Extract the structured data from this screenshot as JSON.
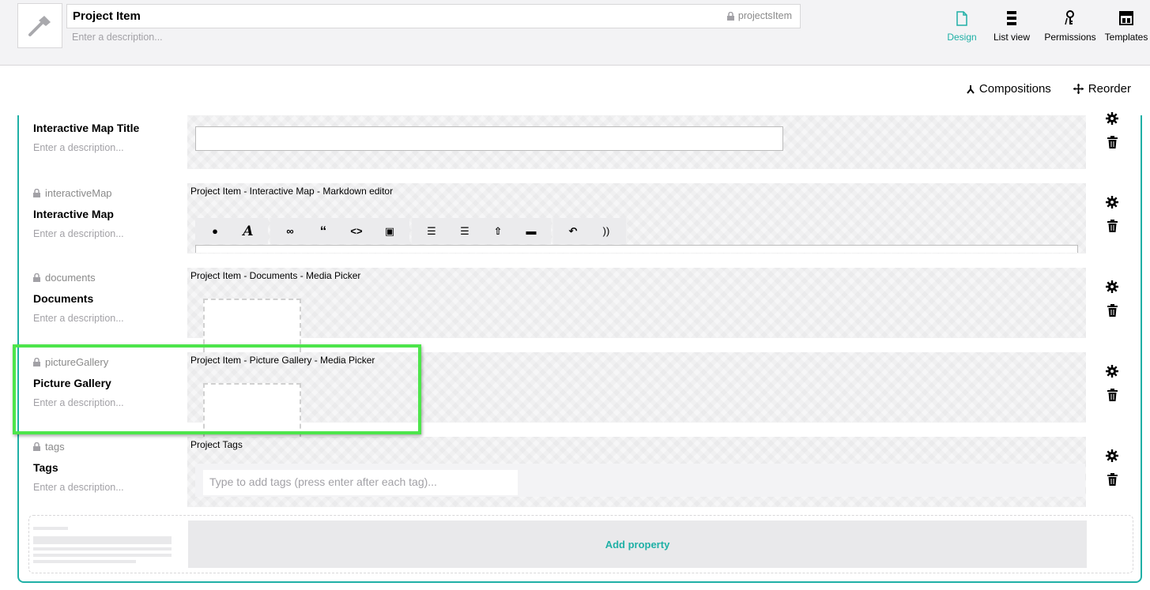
{
  "header": {
    "name": "Project Item",
    "alias": "projectsItem",
    "description_placeholder": "Enter a description...",
    "tabs": [
      {
        "label": "Design",
        "icon": "document-icon",
        "active": true
      },
      {
        "label": "List view",
        "icon": "list-icon",
        "active": false
      },
      {
        "label": "Permissions",
        "icon": "keys-icon",
        "active": false
      },
      {
        "label": "Templates",
        "icon": "layout-icon",
        "active": false
      }
    ]
  },
  "toolbar": {
    "compositions_label": "Compositions",
    "reorder_label": "Reorder"
  },
  "properties": [
    {
      "alias": "",
      "label": "Interactive Map Title",
      "description_placeholder": "Enter a description...",
      "editor": "",
      "editor_kind": "textstring"
    },
    {
      "alias": "interactiveMap",
      "label": "Interactive Map",
      "description_placeholder": "Enter a description...",
      "editor": "Project Item - Interactive Map - Markdown editor",
      "editor_kind": "markdown"
    },
    {
      "alias": "documents",
      "label": "Documents",
      "description_placeholder": "Enter a description...",
      "editor": "Project Item - Documents - Media Picker",
      "editor_kind": "media"
    },
    {
      "alias": "pictureGallery",
      "label": "Picture Gallery",
      "description_placeholder": "Enter a description...",
      "editor": "Project Item - Picture Gallery - Media Picker",
      "editor_kind": "media"
    },
    {
      "alias": "tags",
      "label": "Tags",
      "description_placeholder": "Enter a description...",
      "editor": "Project Tags",
      "editor_kind": "tags",
      "tags_placeholder": "Type to add tags (press enter after each tag)..."
    }
  ],
  "add_property_label": "Add property",
  "colors": {
    "accent": "#1fb0a6",
    "highlight": "#4de54b"
  }
}
